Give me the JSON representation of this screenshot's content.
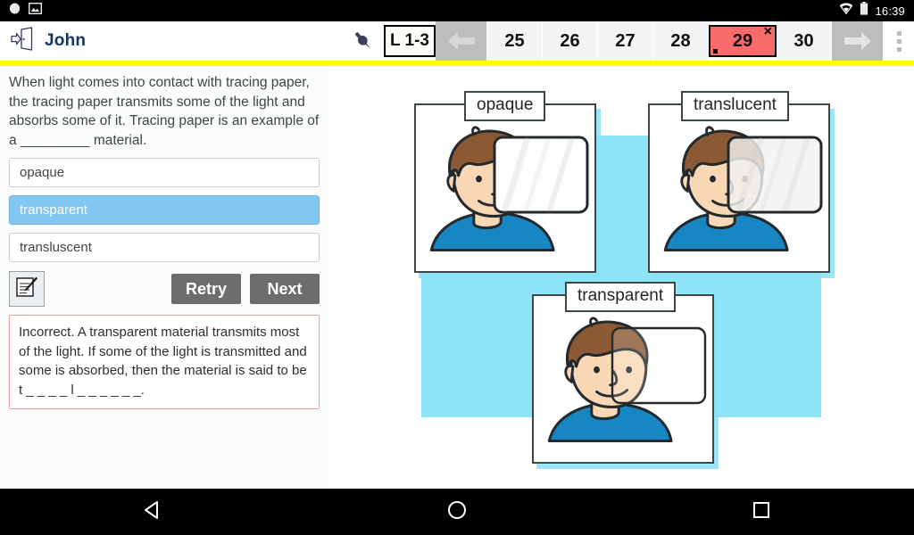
{
  "statusbar": {
    "clock": "16:39",
    "icons": [
      "record-icon",
      "image-icon",
      "wifi-icon",
      "battery-icon"
    ]
  },
  "toolbar": {
    "exit_icon": "exit-door-icon",
    "user_name": "John",
    "pin_icon": "pin-icon",
    "lesson_label": "L 1-3",
    "prev_label": "",
    "next_label": "",
    "menu_icon": "kebab-menu-icon",
    "pages": [
      {
        "label": "25",
        "state": "normal"
      },
      {
        "label": "26",
        "state": "normal"
      },
      {
        "label": "27",
        "state": "normal"
      },
      {
        "label": "28",
        "state": "normal"
      },
      {
        "label": "29",
        "state": "current-incorrect"
      },
      {
        "label": "30",
        "state": "normal"
      }
    ],
    "current_page_mark": "×",
    "accent_rule_color": "#ffff00"
  },
  "question": {
    "text": "When light comes into contact with tracing paper, the tracing paper transmits some of the light and absorbs some of it. Tracing paper is an example of a _________ material.",
    "options": [
      {
        "label": "opaque",
        "selected": false
      },
      {
        "label": "transparent",
        "selected": true
      },
      {
        "label": "transluscent",
        "selected": false
      }
    ],
    "note_icon": "note-edit-icon",
    "retry_label": "Retry",
    "next_label": "Next",
    "feedback": "Incorrect. A transparent material transmits most of the light. If some of the light is transmitted and some is absorbed, then the material is said to be t _ _ _ _ l _ _ _ _ _ _.",
    "feedback_border_color": "#e8a0a0",
    "selected_option_color": "#82c7f2"
  },
  "illustration": {
    "background_color": "#8ee5f7",
    "panels": [
      {
        "label": "opaque",
        "name": "panel-opaque"
      },
      {
        "label": "translucent",
        "name": "panel-translucent"
      },
      {
        "label": "transparent",
        "name": "panel-transparent"
      }
    ]
  },
  "navbar": {
    "back_icon": "back-triangle-icon",
    "home_icon": "home-circle-icon",
    "recents_icon": "recents-square-icon"
  }
}
